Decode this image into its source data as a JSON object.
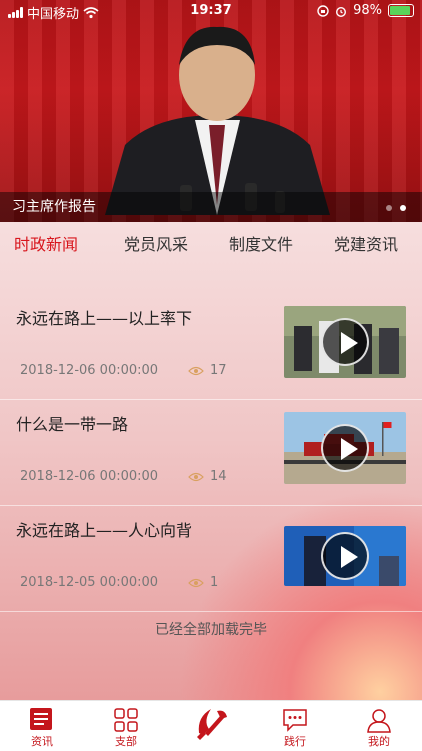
{
  "status": {
    "carrier": "中国移动",
    "time": "19:37",
    "battery": "98%"
  },
  "banner": {
    "caption": "习主席作报告",
    "page_count": 2,
    "active_page": 2
  },
  "tabs": [
    {
      "label": "时政新闻",
      "active": true
    },
    {
      "label": "党员风采",
      "active": false
    },
    {
      "label": "制度文件",
      "active": false
    },
    {
      "label": "党建资讯",
      "active": false
    }
  ],
  "news": [
    {
      "title": "永远在路上——以上率下",
      "date": "2018-12-06 00:00:00",
      "views": "17",
      "thumb": "crowd-scene"
    },
    {
      "title": "什么是一带一路",
      "date": "2018-12-06 00:00:00",
      "views": "14",
      "thumb": "tiananmen-square"
    },
    {
      "title": "永远在路上——人心向背",
      "date": "2018-12-05 00:00:00",
      "views": "1",
      "thumb": "blue-stage"
    }
  ],
  "footer_note": "已经全部加载完毕",
  "bottom_nav": [
    {
      "label": "资讯",
      "icon": "news-icon"
    },
    {
      "label": "支部",
      "icon": "grid-icon"
    },
    {
      "label": "",
      "icon": "party-emblem-icon"
    },
    {
      "label": "践行",
      "icon": "chat-icon"
    },
    {
      "label": "我的",
      "icon": "profile-icon"
    }
  ],
  "colors": {
    "accent": "#d8161d",
    "banner_red": "#c8181c"
  }
}
